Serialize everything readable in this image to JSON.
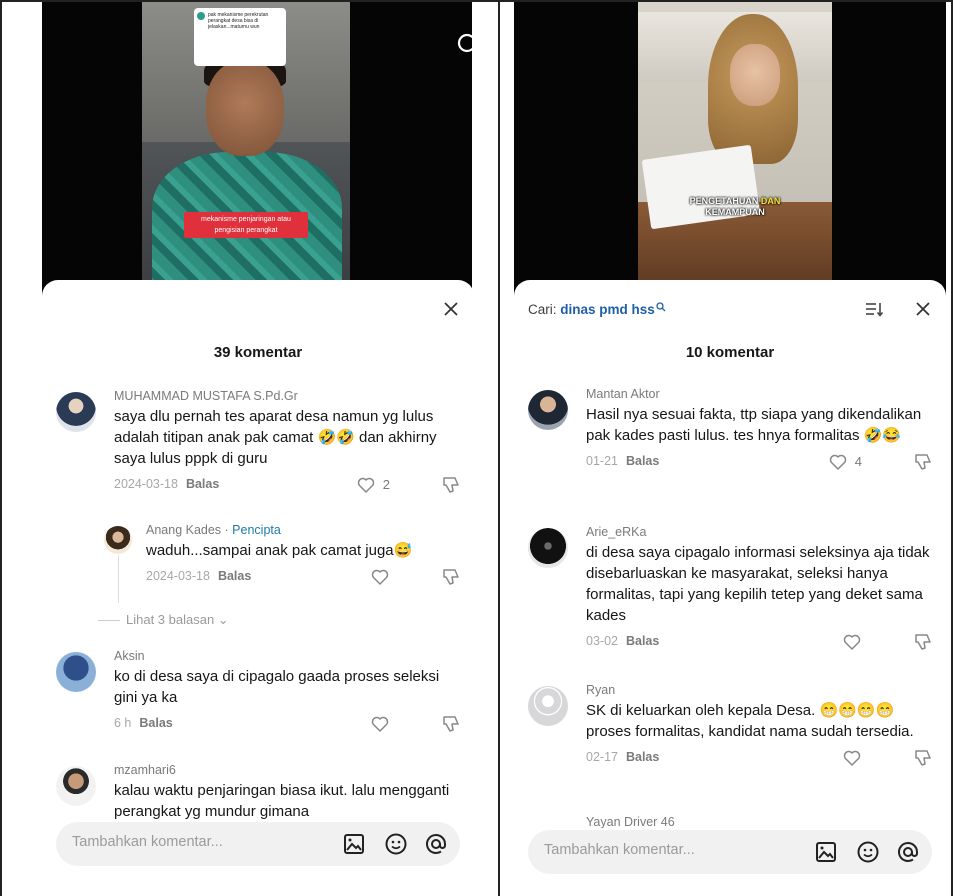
{
  "left": {
    "video": {
      "bubble_text": "pak mekanisme perekrutan perangkat desa bisa di jelaskan...maturnu wun",
      "caption": "mekanisme penjaringan atau pengisian perangkat"
    },
    "count": "39 komentar",
    "comments": [
      {
        "username": "MUHAMMAD MUSTAFA S.Pd.Gr",
        "text": "saya dlu pernah tes aparat desa namun yg lulus adalah titipan anak pak camat 🤣🤣 dan akhirny saya lulus pppk di guru",
        "date": "2024-03-18",
        "reply": "Balas",
        "likes": "2"
      },
      {
        "username": "Anang Kades · ",
        "creator": "Pencipta",
        "text": "waduh...sampai anak pak camat juga😅",
        "date": "2024-03-18",
        "reply": "Balas"
      },
      {
        "username": "Aksin",
        "text": "ko di desa saya di cipagalo gaada proses seleksi gini ya ka",
        "date": "6 h",
        "reply": "Balas"
      },
      {
        "username": "mzamhari6",
        "text": "kalau waktu penjaringan biasa ikut. lalu mengganti perangkat yg mundur gimana"
      }
    ],
    "view_replies": "Lihat 3 balasan ⌄",
    "input_placeholder": "Tambahkan komentar..."
  },
  "right": {
    "video": {
      "caption_part1": "PENGETAHUAN ",
      "caption_highlight": "DAN",
      "caption_part2": "KEMAMPUAN"
    },
    "search_label": "Cari: ",
    "search_query": "dinas pmd hss",
    "count": "10 komentar",
    "comments": [
      {
        "username": "Mantan Aktor",
        "text": "Hasil nya sesuai fakta, ttp siapa yang dikendalikan pak kades pasti lulus. tes hnya formalitas 🤣😂",
        "date": "01-21",
        "reply": "Balas",
        "likes": "4"
      },
      {
        "username": "Arie_eRKa",
        "text": "di desa saya cipagalo informasi seleksinya aja tidak disebarluaskan ke masyarakat, seleksi hanya formalitas, tapi yang kepilih tetep yang deket sama kades",
        "date": "03-02",
        "reply": "Balas"
      },
      {
        "username": "Ryan",
        "text": "SK di keluarkan oleh kepala Desa. 😁😁😁😁 proses formalitas, kandidat nama sudah tersedia.",
        "date": "02-17",
        "reply": "Balas"
      },
      {
        "username": "Yayan Driver 46"
      }
    ],
    "input_placeholder": "Tambahkan komentar..."
  },
  "colors": {
    "accent_link": "#1f5fa8",
    "creator_label": "#1f7aa8",
    "caption_red": "#e0303c",
    "caption_highlight": "#ffe033"
  }
}
